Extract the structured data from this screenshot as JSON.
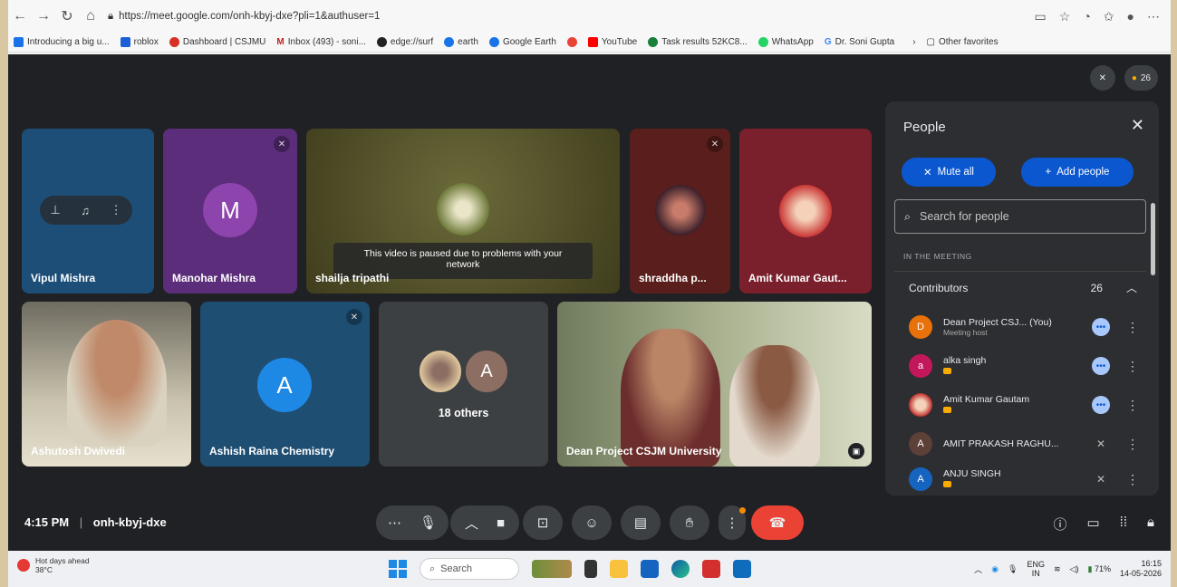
{
  "browser": {
    "url": "https://meet.google.com/onh-kbyj-dxe?pli=1&authuser=1",
    "bookmarks": [
      {
        "label": "Introducing a big u...",
        "color": "#1a73e8"
      },
      {
        "label": "roblox",
        "color": "#1b5fd6"
      },
      {
        "label": "Dashboard | CSJMU",
        "color": "#d93025"
      },
      {
        "label": "Inbox (493) - soni...",
        "color": "#c5221f"
      },
      {
        "label": "edge://surf",
        "color": "#222222"
      },
      {
        "label": "earth",
        "color": "#1a73e8"
      },
      {
        "label": "Google Earth",
        "color": "#1a73e8"
      },
      {
        "label": "",
        "color": "#ea4335"
      },
      {
        "label": "YouTube",
        "color": "#ff0000"
      },
      {
        "label": "Task results 52KC8...",
        "color": "#188038"
      },
      {
        "label": "WhatsApp",
        "color": "#25d366"
      },
      {
        "label": "Dr. Soni Gupta",
        "color": "#4285f4"
      }
    ],
    "other_favorites": "Other favorites"
  },
  "meet": {
    "participant_count": "26",
    "tiles": [
      {
        "name": "Vipul Mishra",
        "bg": "#1c4e78"
      },
      {
        "name": "Manohar Mishra",
        "initial": "M",
        "bg": "#5b2d7a",
        "avatar_color": "#8e44ad"
      },
      {
        "name": "shailja tripathi",
        "bg": "#4c4a22",
        "paused_msg": "This video is paused due to problems with your network"
      },
      {
        "name": "shraddha p...",
        "bg": "#5a1f1c"
      },
      {
        "name": "Amit Kumar Gaut...",
        "bg": "#7a1f2c"
      },
      {
        "name": "Ashutosh Dwivedi",
        "bg": "#8a8577"
      },
      {
        "name": "Ashish Raina Chemistry",
        "initial": "A",
        "bg": "#1f4e73",
        "avatar_color": "#1e88e5"
      },
      {
        "name": "18 others",
        "initial": "A",
        "bg": "#3c4043"
      },
      {
        "name": "Dean Project CSJM University",
        "bg": "#7b7f72"
      }
    ],
    "meeting_time": "4:15 PM",
    "meeting_code": "onh-kbyj-dxe"
  },
  "people_panel": {
    "title": "People",
    "mute_all": "Mute all",
    "add_people": "Add people",
    "search_placeholder": "Search for people",
    "section": "IN THE MEETING",
    "contributors_label": "Contributors",
    "contributors_count": "26",
    "people": [
      {
        "initial": "D",
        "name": "Dean Project CSJ...  (You)",
        "sub": "Meeting host",
        "color": "#e8710a",
        "control": "more"
      },
      {
        "initial": "a",
        "name": "alka singh",
        "sub": "",
        "color": "#c2185b",
        "control": "more"
      },
      {
        "initial": "",
        "name": "Amit Kumar Gautam",
        "sub": "",
        "color": "#b71c1c",
        "control": "more"
      },
      {
        "initial": "A",
        "name": "AMIT PRAKASH RAGHU...",
        "sub": "",
        "color": "#5d4037",
        "control": "muted"
      },
      {
        "initial": "A",
        "name": "ANJU SINGH",
        "sub": "",
        "color": "#1565c0",
        "control": "muted"
      }
    ]
  },
  "taskbar": {
    "weather_title": "Hot days ahead",
    "weather_temp": "38°C",
    "search": "Search",
    "lang_top": "ENG",
    "lang_bottom": "IN",
    "battery": "71%",
    "time": "16:15",
    "date": "14-05-2026"
  }
}
